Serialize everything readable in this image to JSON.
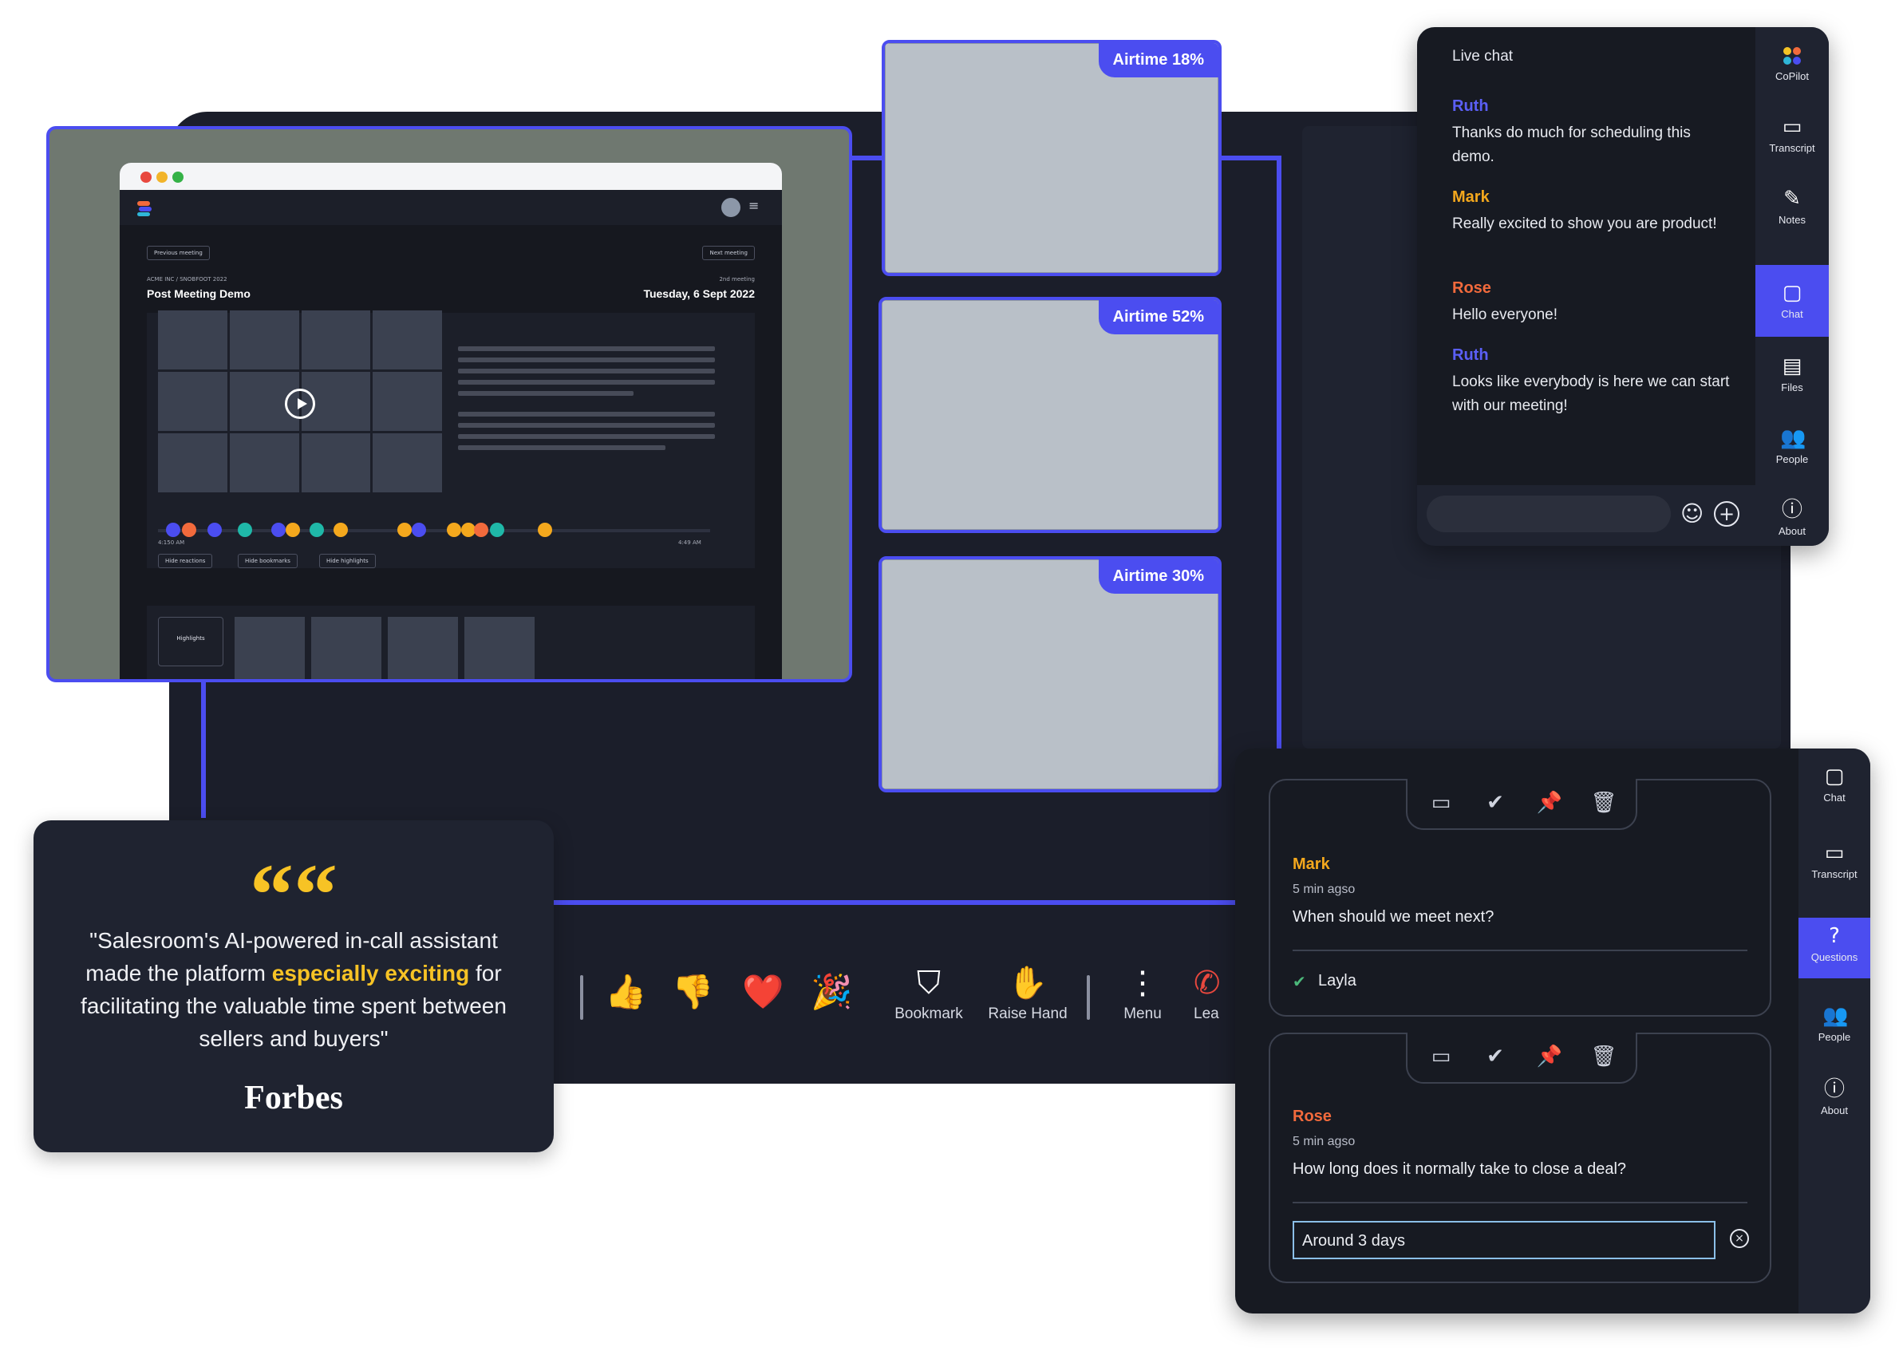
{
  "app_window": {
    "previous_meeting": "Previous meeting",
    "next_meeting": "Next meeting",
    "breadcrumb": "ACME INC / SNOBFOOT 2022",
    "meeting_label": "2nd meeting",
    "title": "Post Meeting Demo",
    "date": "Tuesday, 6 Sept 2022",
    "time_start": "4:150 AM",
    "time_end": "4:49 AM",
    "buttons": [
      "Hide reactions",
      "Hide bookmarks",
      "Hide highlights"
    ],
    "highlights_label": "Highlights"
  },
  "videos": [
    {
      "airtime": "Airtime 18%"
    },
    {
      "airtime": "Airtime 52%"
    },
    {
      "airtime": "Airtime 30%"
    }
  ],
  "live_chat": {
    "title": "Live chat",
    "messages": [
      {
        "name": "Ruth",
        "text": "Thanks do much for scheduling this demo.",
        "color": "#5b5ff7"
      },
      {
        "name": "Mark",
        "text": "Really excited to show you are product!",
        "color": "#f4a81d"
      },
      {
        "name": "Rose",
        "text": "Hello everyone!",
        "color": "#f26a3c"
      },
      {
        "name": "Ruth",
        "text": "Looks like everybody is here we can start with our meeting!",
        "color": "#5b5ff7"
      }
    ],
    "sidebar": [
      {
        "label": "CoPilot",
        "icon": "copilot-icon"
      },
      {
        "label": "Transcript",
        "icon": "transcript-icon"
      },
      {
        "label": "Notes",
        "icon": "notes-icon"
      },
      {
        "label": "Chat",
        "icon": "chat-icon"
      },
      {
        "label": "Files",
        "icon": "files-icon"
      },
      {
        "label": "People",
        "icon": "people-icon"
      },
      {
        "label": "About",
        "icon": "about-icon"
      }
    ]
  },
  "toolbar": {
    "reactions": [
      "👍",
      "👎",
      "❤️",
      "🎉"
    ],
    "bookmark": "Bookmark",
    "raise_hand": "Raise Hand",
    "menu": "Menu",
    "leave_partial": "Lea"
  },
  "quote": {
    "mark": "““",
    "text_before": "\"Salesroom's AI-powered in-call assistant made the platform ",
    "highlight": "especially exciting",
    "text_after": " for facilitating the valuable time spent between sellers and buyers\"",
    "source": "Forbes"
  },
  "questions": {
    "sidebar": [
      {
        "label": "Chat",
        "icon": "chat-icon"
      },
      {
        "label": "Transcript",
        "icon": "transcript-icon"
      },
      {
        "label": "Questions",
        "icon": "questions-icon"
      },
      {
        "label": "People",
        "icon": "people-icon"
      },
      {
        "label": "About",
        "icon": "about-icon"
      }
    ],
    "items": [
      {
        "name": "Mark",
        "time": "5 min agso",
        "question": "When should we meet next?",
        "answered_by": "Layla",
        "name_color": "#f4a81d"
      },
      {
        "name": "Rose",
        "time": "5 min agso",
        "question": "How long does it normally take to close a deal?",
        "answer_value": "Around 3 days",
        "name_color": "#f26a3c"
      }
    ]
  }
}
